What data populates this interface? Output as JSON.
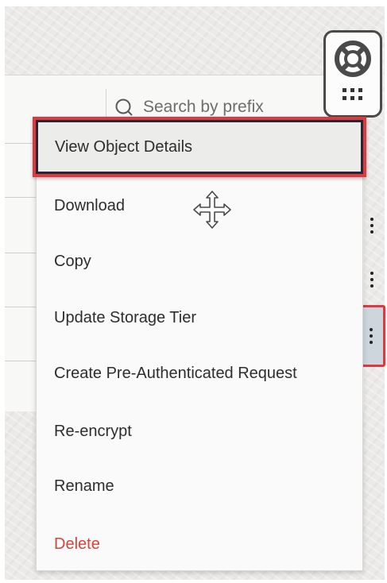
{
  "search": {
    "placeholder": "Search by prefix",
    "icon": "search-icon"
  },
  "help": {
    "icon": "lifebuoy-icon",
    "grid_icon": "grid-icon"
  },
  "menu": {
    "items": [
      {
        "label": "View Object Details",
        "highlighted": true
      },
      {
        "label": "Download"
      },
      {
        "label": "Copy"
      },
      {
        "label": "Update Storage Tier"
      },
      {
        "label": "Create Pre-Authenticated Request"
      },
      {
        "label": "Re-encrypt"
      },
      {
        "label": "Rename"
      },
      {
        "label": "Delete",
        "color": "#d6453a"
      }
    ]
  },
  "row_actions": {
    "icon": "kebab-menu-icon",
    "active_row": 3
  },
  "colors": {
    "highlight_border": "#e0383e",
    "danger_text": "#d6453a",
    "menu_background": "#fafafa"
  },
  "cursor": "move-cursor-icon"
}
